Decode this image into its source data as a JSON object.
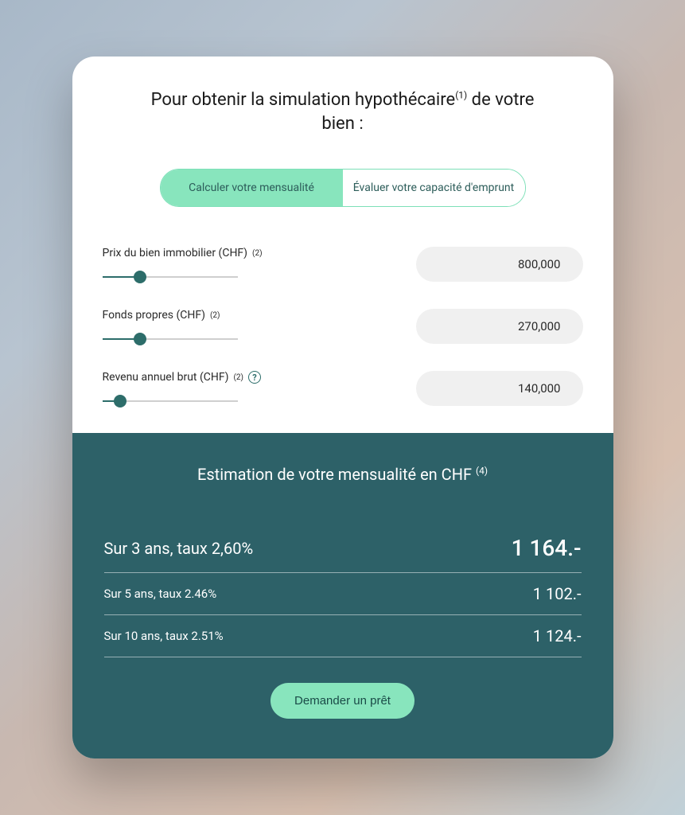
{
  "title": {
    "prefix": "Pour obtenir la simulation hypothécaire",
    "sup": "(1)",
    "suffix": " de votre bien :"
  },
  "tabs": {
    "active": "Calculer votre mensualité",
    "inactive": "Évaluer votre capacité d'emprunt"
  },
  "fields": {
    "price": {
      "label": "Prix du bien immobilier (CHF)",
      "sup": "(2)",
      "value": "800,000",
      "slider_pct": 28
    },
    "equity": {
      "label": "Fonds propres (CHF)",
      "sup": "(2)",
      "value": "270,000",
      "slider_pct": 28
    },
    "income": {
      "label": "Revenu annuel brut (CHF)",
      "sup": "(2)",
      "value": "140,000",
      "slider_pct": 13,
      "help": "?"
    }
  },
  "results": {
    "title": "Estimation de votre mensualité en CHF",
    "sup": "(4)",
    "rows": [
      {
        "label": "Sur 3 ans, taux 2,60%",
        "value": "1 164.-"
      },
      {
        "label": "Sur 5 ans, taux 2.46%",
        "value": "1 102.-"
      },
      {
        "label": "Sur 10 ans, taux 2.51%",
        "value": "1 124.-"
      }
    ],
    "cta": "Demander un prêt"
  }
}
